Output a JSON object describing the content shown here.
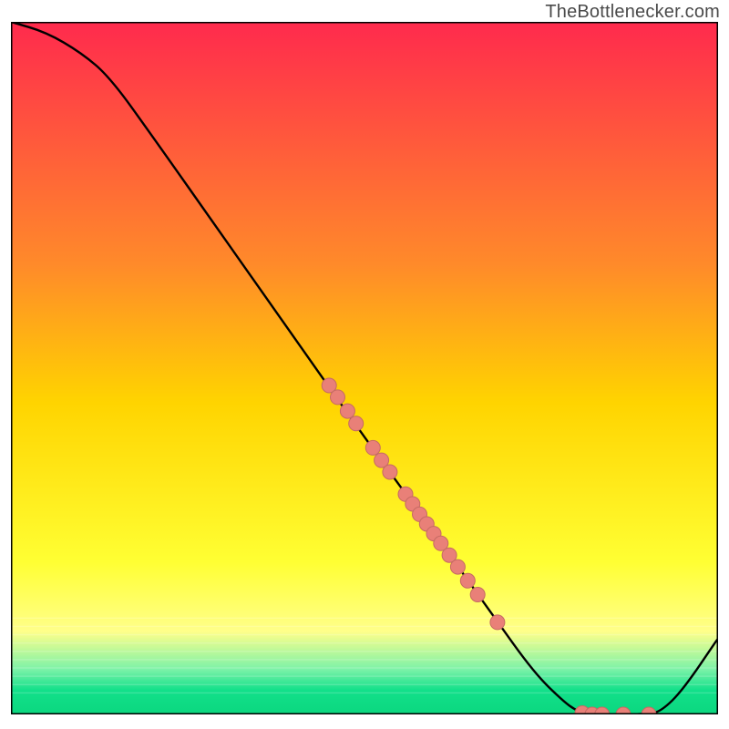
{
  "watermark": "TheBottlenecker.com",
  "colors": {
    "gradient_top": "#ff2a4d",
    "gradient_mid": "#ffd400",
    "gradient_yellow_light": "#ffff8a",
    "gradient_green_light": "#7cf2a8",
    "gradient_green": "#12e08a",
    "curve": "#000000",
    "dot_fill": "#e98078",
    "dot_stroke": "#c56a63",
    "frame": "#000000"
  },
  "chart_data": {
    "type": "line",
    "title": "",
    "xlabel": "",
    "ylabel": "",
    "xlim": [
      0,
      100
    ],
    "ylim": [
      0,
      100
    ],
    "legend": false,
    "grid": false,
    "note": "No numeric axis ticks or labels are rendered in the image; x/y are normalized 0–100. Curve and point y-values are read from the plot as percentages of the inner plot height (0 at bottom, 100 at top).",
    "curve": [
      {
        "x": 0,
        "y": 100
      },
      {
        "x": 5,
        "y": 98.5
      },
      {
        "x": 10,
        "y": 95.5
      },
      {
        "x": 14,
        "y": 92
      },
      {
        "x": 20,
        "y": 83.5
      },
      {
        "x": 30,
        "y": 69
      },
      {
        "x": 40,
        "y": 54.5
      },
      {
        "x": 50,
        "y": 40
      },
      {
        "x": 60,
        "y": 26
      },
      {
        "x": 68,
        "y": 14.5
      },
      {
        "x": 74,
        "y": 6
      },
      {
        "x": 78,
        "y": 2
      },
      {
        "x": 80,
        "y": 0.5
      },
      {
        "x": 82,
        "y": 0
      },
      {
        "x": 90,
        "y": 0
      },
      {
        "x": 92,
        "y": 0.5
      },
      {
        "x": 95,
        "y": 3.5
      },
      {
        "x": 100,
        "y": 11
      }
    ],
    "series": [
      {
        "name": "points",
        "points": [
          {
            "x": 45.0,
            "y": 47.5
          },
          {
            "x": 46.2,
            "y": 45.8
          },
          {
            "x": 47.6,
            "y": 43.8
          },
          {
            "x": 48.8,
            "y": 42.0
          },
          {
            "x": 51.2,
            "y": 38.5
          },
          {
            "x": 52.4,
            "y": 36.7
          },
          {
            "x": 53.6,
            "y": 35.0
          },
          {
            "x": 55.8,
            "y": 31.8
          },
          {
            "x": 56.8,
            "y": 30.4
          },
          {
            "x": 57.8,
            "y": 28.9
          },
          {
            "x": 58.8,
            "y": 27.5
          },
          {
            "x": 59.8,
            "y": 26.1
          },
          {
            "x": 60.8,
            "y": 24.7
          },
          {
            "x": 62.0,
            "y": 23.0
          },
          {
            "x": 63.2,
            "y": 21.3
          },
          {
            "x": 64.6,
            "y": 19.3
          },
          {
            "x": 66.0,
            "y": 17.3
          },
          {
            "x": 68.8,
            "y": 13.3
          },
          {
            "x": 80.8,
            "y": 0.2
          },
          {
            "x": 82.2,
            "y": 0.0
          },
          {
            "x": 83.6,
            "y": 0.0
          },
          {
            "x": 86.6,
            "y": 0.0
          },
          {
            "x": 90.2,
            "y": 0.0
          }
        ]
      }
    ]
  }
}
